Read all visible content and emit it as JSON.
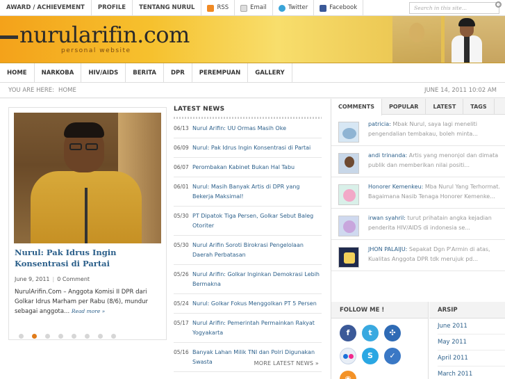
{
  "topnav": {
    "items": [
      "AWARD / ACHIEVEMENT",
      "PROFILE",
      "TENTANG NURUL"
    ],
    "social": [
      {
        "label": "RSS",
        "icon": "rss-icon"
      },
      {
        "label": "Email",
        "icon": "email-icon"
      },
      {
        "label": "Twitter",
        "icon": "twitter-icon"
      },
      {
        "label": "Facebook",
        "icon": "facebook-icon"
      }
    ],
    "search_placeholder": "Search in this site..."
  },
  "header": {
    "logo": "nurularifin.com",
    "tagline": "personal website"
  },
  "mainnav": [
    "HOME",
    "NARKOBA",
    "HIV/AIDS",
    "BERITA",
    "DPR",
    "PEREMPUAN",
    "GALLERY"
  ],
  "breadcrumb": {
    "prefix": "YOU ARE HERE:",
    "current": "HOME",
    "datetime": "JUNE 14, 2011 10:02 AM"
  },
  "featured": {
    "title": "Nurul: Pak Idrus Ingin Konsentrasi di Partai",
    "date": "June 9, 2011",
    "comments": "0 Comment",
    "excerpt": "NurulArifin.Com – Anggota Komisi II DPR dari Golkar Idrus Marham per Rabu (8/6), mundur sebagai anggota...",
    "read_more": "Read more »",
    "slides": 8,
    "active_slide": 2
  },
  "latest": {
    "heading": "LATEST NEWS",
    "items": [
      {
        "date": "06/13",
        "title": "Nurul Arifin: UU Ormas Masih Oke"
      },
      {
        "date": "06/09",
        "title": "Nurul: Pak Idrus Ingin Konsentrasi di Partai"
      },
      {
        "date": "06/07",
        "title": "Perombakan Kabinet Bukan Hal Tabu"
      },
      {
        "date": "06/01",
        "title": "Nurul: Masih Banyak Artis di DPR yang Bekerja Maksimal!"
      },
      {
        "date": "05/30",
        "title": "PT Dipatok Tiga Persen, Golkar Sebut Baleg Otoriter"
      },
      {
        "date": "05/30",
        "title": "Nurul Arifin Soroti Birokrasi Pengelolaan Daerah Perbatasan"
      },
      {
        "date": "05/26",
        "title": "Nurul Arifin: Golkar Inginkan Demokrasi Lebih Bermakna"
      },
      {
        "date": "05/24",
        "title": "Nurul: Golkar Fokus Menggolkan PT 5 Persen"
      },
      {
        "date": "05/17",
        "title": "Nurul Arifin: Pemerintah Permainkan Rakyat Yogyakarta"
      },
      {
        "date": "05/16",
        "title": "Banyak Lahan Milik TNI dan Polri Digunakan Swasta"
      }
    ],
    "more": "MORE LATEST NEWS »"
  },
  "sidebar": {
    "tabs": [
      "COMMENTS",
      "POPULAR",
      "LATEST",
      "TAGS"
    ],
    "comments": [
      {
        "name": "patricia:",
        "text": "Mbak Nurul, saya lagi meneliti pengendalian tembakau, boleh minta..."
      },
      {
        "name": "andi trinanda:",
        "text": "Artis yang menonjol dan dimata publik dan memberikan nilai positi..."
      },
      {
        "name": "Honorer Kemenkeu:",
        "text": "Mba Nurul Yang Terhormat. Bagaimana Nasib Tenaga Honorer Kemenke..."
      },
      {
        "name": "irwan syahril:",
        "text": "turut prihatain angka kejadian penderita HIV/AIDS di indonesia se..."
      },
      {
        "name": "JHON PALAIJU:",
        "text": "Sepakat Dgn P'Armin di atas, Kualitas Anggota DPR tdk merujuk pd..."
      }
    ],
    "follow_heading": "FOLLOW ME !",
    "follow_icons": [
      "facebook-icon",
      "twitter-icon",
      "delicious-icon",
      "flickr-icon",
      "skype-icon",
      "hyves-icon",
      "rss-icon"
    ],
    "arsip_heading": "ARSIP",
    "arsip": [
      "June 2011",
      "May 2011",
      "April 2011",
      "March 2011"
    ]
  }
}
